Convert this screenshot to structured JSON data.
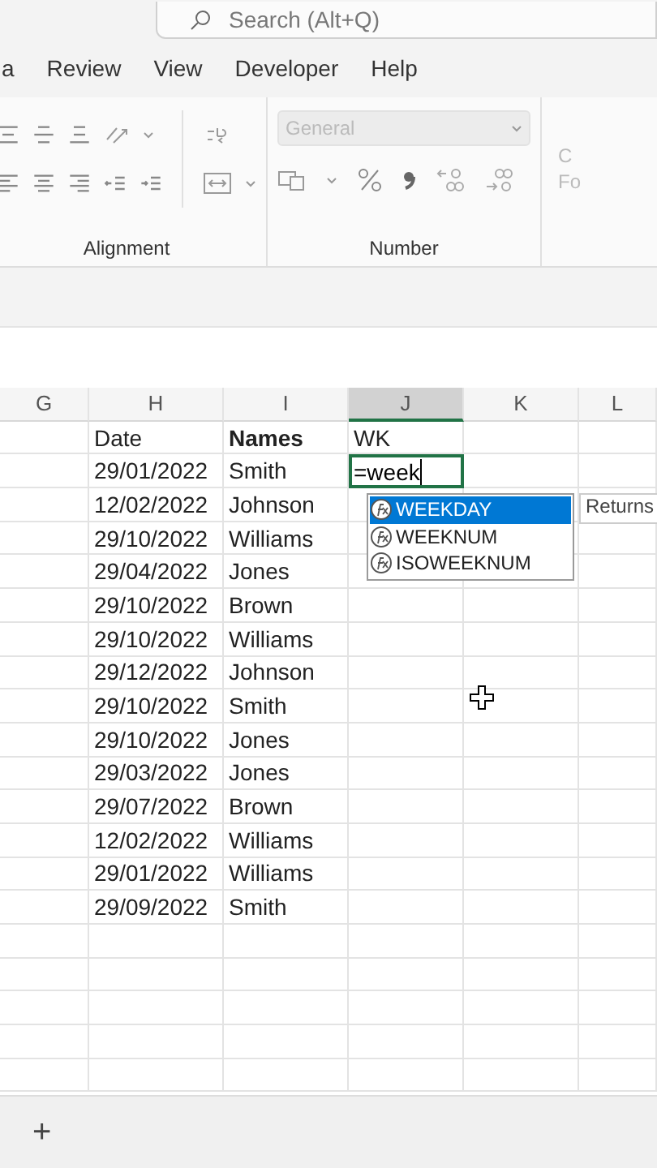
{
  "search": {
    "placeholder": "Search (Alt+Q)"
  },
  "menu_tabs": [
    {
      "label": "a",
      "selected": false
    },
    {
      "label": "Review",
      "selected": false
    },
    {
      "label": "View",
      "selected": false
    },
    {
      "label": "Developer",
      "selected": false
    },
    {
      "label": "Help",
      "selected": false
    }
  ],
  "ribbon": {
    "alignment_label": "Alignment",
    "number_label": "Number",
    "number_format": "General",
    "cut_group_lines": [
      "C",
      "Fo"
    ]
  },
  "columns": [
    {
      "label": "G",
      "selected": false
    },
    {
      "label": "H",
      "selected": false
    },
    {
      "label": "I",
      "selected": false
    },
    {
      "label": "J",
      "selected": true
    },
    {
      "label": "K",
      "selected": false
    },
    {
      "label": "L",
      "selected": false
    }
  ],
  "header": {
    "date": "Date",
    "names": "Names",
    "wk": "WK"
  },
  "rows": [
    {
      "date": "29/01/2022",
      "name": "Smith",
      "editing": true,
      "value": "=week"
    },
    {
      "date": "12/02/2022",
      "name": "Johnson",
      "editing": false
    },
    {
      "date": "29/10/2022",
      "name": "Williams",
      "editing": false
    },
    {
      "date": "29/04/2022",
      "name": "Jones",
      "editing": false
    },
    {
      "date": "29/10/2022",
      "name": "Brown",
      "editing": false
    },
    {
      "date": "29/10/2022",
      "name": "Williams",
      "editing": false
    },
    {
      "date": "29/12/2022",
      "name": "Johnson",
      "editing": false
    },
    {
      "date": "29/10/2022",
      "name": "Smith",
      "editing": false
    },
    {
      "date": "29/10/2022",
      "name": "Jones",
      "editing": false
    },
    {
      "date": "29/03/2022",
      "name": "Jones",
      "editing": false
    },
    {
      "date": "29/07/2022",
      "name": "Brown",
      "editing": false
    },
    {
      "date": "12/02/2022",
      "name": "Williams",
      "editing": false
    },
    {
      "date": "29/01/2022",
      "name": "Williams",
      "editing": false
    },
    {
      "date": "29/09/2022",
      "name": "Smith",
      "editing": false
    }
  ],
  "autocomplete": {
    "items": [
      {
        "label": "WEEKDAY",
        "selected": true
      },
      {
        "label": "WEEKNUM",
        "selected": false
      },
      {
        "label": "ISOWEEKNUM",
        "selected": false
      }
    ],
    "tooltip": "Returns"
  },
  "sheet_bar": {
    "add": "+"
  }
}
